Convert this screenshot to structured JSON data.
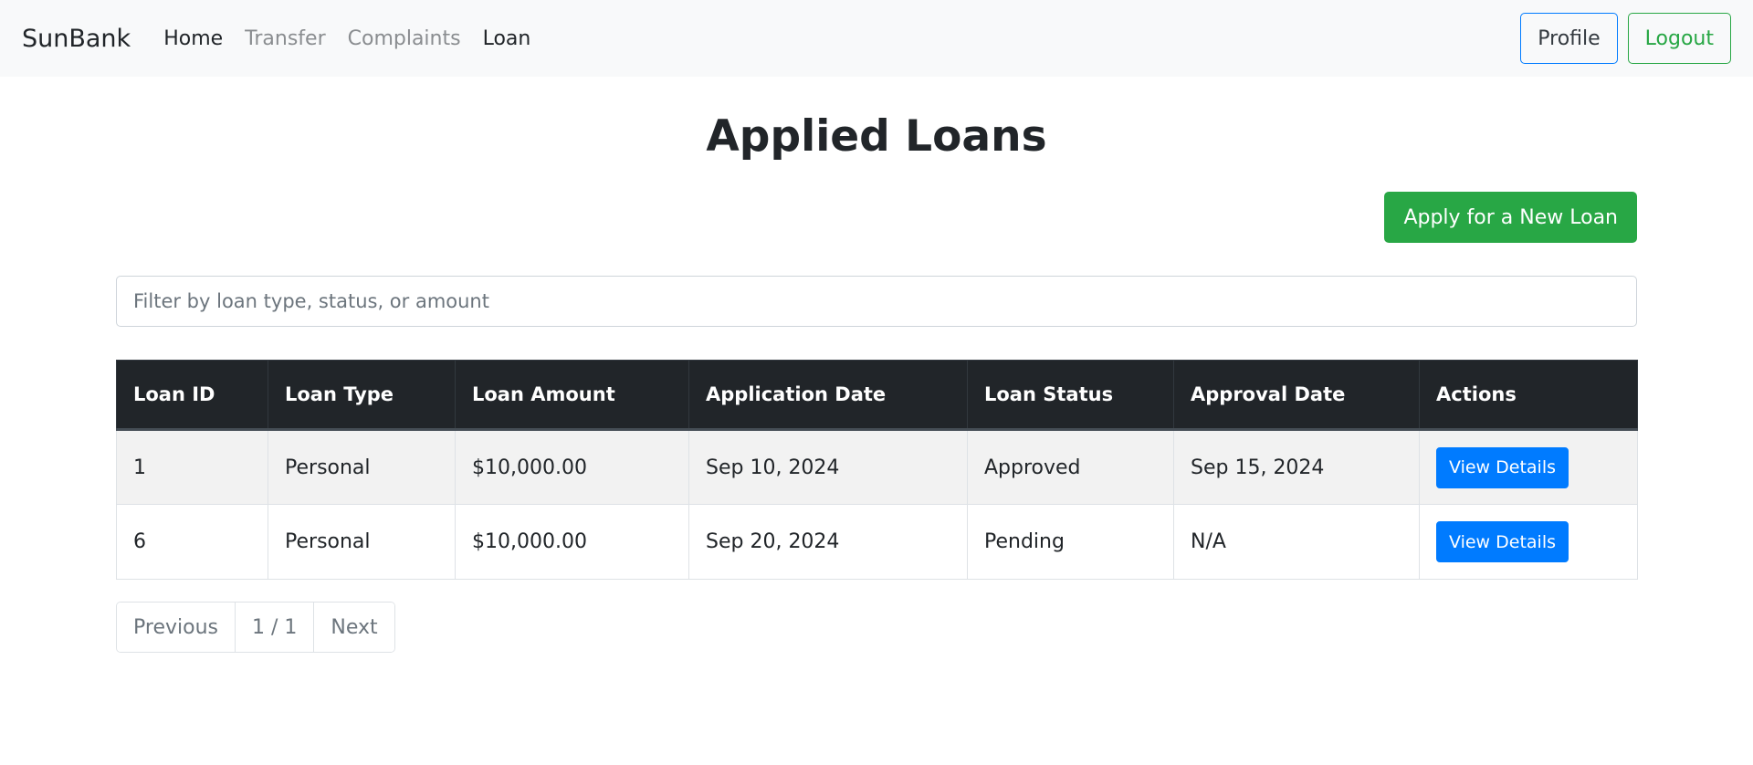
{
  "navbar": {
    "brand": "SunBank",
    "links": [
      {
        "label": "Home",
        "state": "active"
      },
      {
        "label": "Transfer",
        "state": "muted"
      },
      {
        "label": "Complaints",
        "state": "muted"
      },
      {
        "label": "Loan",
        "state": "active"
      }
    ],
    "profile_label": "Profile",
    "logout_label": "Logout"
  },
  "page": {
    "title": "Applied Loans",
    "apply_label": "Apply for a New Loan",
    "filter_placeholder": "Filter by loan type, status, or amount"
  },
  "table": {
    "columns": [
      "Loan ID",
      "Loan Type",
      "Loan Amount",
      "Application Date",
      "Loan Status",
      "Approval Date",
      "Actions"
    ],
    "rows": [
      {
        "id": "1",
        "type": "Personal",
        "amount": "$10,000.00",
        "application_date": "Sep 10, 2024",
        "status": "Approved",
        "approval_date": "Sep 15, 2024",
        "action_label": "View Details"
      },
      {
        "id": "6",
        "type": "Personal",
        "amount": "$10,000.00",
        "application_date": "Sep 20, 2024",
        "status": "Pending",
        "approval_date": "N/A",
        "action_label": "View Details"
      }
    ]
  },
  "pagination": {
    "previous_label": "Previous",
    "page_indicator": "1 / 1",
    "next_label": "Next"
  },
  "colors": {
    "navbar_bg": "#f8f9fa",
    "success": "#28a745",
    "primary": "#007bff",
    "table_header_bg": "#212529"
  }
}
